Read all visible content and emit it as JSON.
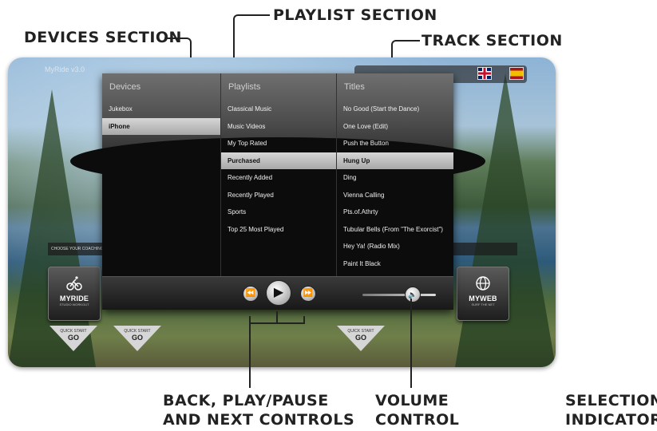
{
  "annotations": {
    "devices": "DEVICES SECTION",
    "playlist": "PLAYLIST SECTION",
    "track": "TRACK SECTION",
    "controls_line1": "BACK, PLAY/PAUSE",
    "controls_line2": "AND NEXT CONTROLS",
    "volume_line1": "VOLUME",
    "volume_line2": "CONTROL",
    "selection_line1": "SELECTION",
    "selection_line2": "INDICATOR"
  },
  "app": {
    "version": "MyRide v3.0",
    "coaching_label": "CHOOSE YOUR COACHING"
  },
  "languages": [
    "uk-flag-icon",
    "spain-flag-icon"
  ],
  "columns": {
    "devices_header": "Devices",
    "playlists_header": "Playlists",
    "titles_header": "Titles"
  },
  "devices": [
    {
      "label": "Jukebox",
      "selected": false
    },
    {
      "label": "iPhone",
      "selected": true
    }
  ],
  "playlists": [
    {
      "label": "Classical Music",
      "selected": false
    },
    {
      "label": "Music Videos",
      "selected": false
    },
    {
      "label": "My Top Rated",
      "selected": false
    },
    {
      "label": "Purchased",
      "selected": true
    },
    {
      "label": "Recently Added",
      "selected": false
    },
    {
      "label": "Recently Played",
      "selected": false
    },
    {
      "label": "Sports",
      "selected": false
    },
    {
      "label": "Top 25 Most Played",
      "selected": false
    }
  ],
  "titles": [
    {
      "label": "No Good (Start the Dance)",
      "selected": false
    },
    {
      "label": "One Love (Edit)",
      "selected": false
    },
    {
      "label": "Push the Button",
      "selected": false
    },
    {
      "label": "Hung Up",
      "selected": true
    },
    {
      "label": "Ding",
      "selected": false
    },
    {
      "label": "Vienna Calling",
      "selected": false
    },
    {
      "label": "Pts.of.Athrty",
      "selected": false
    },
    {
      "label": "Tubular Bells (From \"The Exorcist\")",
      "selected": false
    },
    {
      "label": "Hey Ya! (Radio Mix)",
      "selected": false
    },
    {
      "label": "Paint It Black",
      "selected": false
    }
  ],
  "transport": {
    "back_icon": "⏪",
    "play_icon": "▶",
    "next_icon": "⏩",
    "volume_icon": "🔈",
    "volume_level": 0.7
  },
  "tiles": {
    "myride_name": "MYRIDE",
    "myride_sub": "STUDIO WORKOUT",
    "myweb_name": "MYWEB",
    "myweb_sub": "SURF THE NET"
  },
  "quick_start": {
    "line1": "QUICK START",
    "line2": "GO"
  },
  "colors": {
    "panel": "#0c0c0c",
    "selection": "#c4c4c4"
  }
}
